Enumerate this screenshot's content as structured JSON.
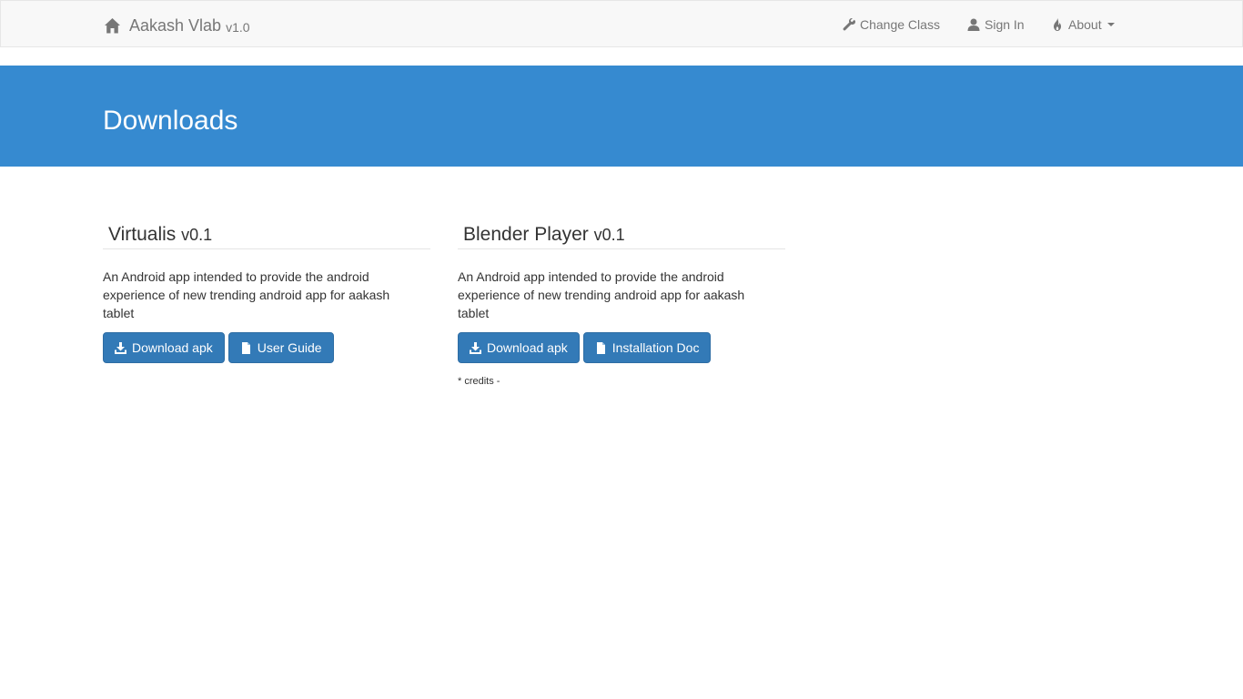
{
  "navbar": {
    "brand_title": "Aakash Vlab",
    "brand_version": "v1.0",
    "links": [
      {
        "label": "Change Class",
        "icon": "wrench-icon"
      },
      {
        "label": "Sign In",
        "icon": "user-icon"
      },
      {
        "label": "About",
        "icon": "fire-icon"
      }
    ]
  },
  "jumbotron": {
    "title": "Downloads"
  },
  "apps": [
    {
      "name": "Virtualis",
      "version": "v0.1",
      "description": "An Android app intended to provide the android experience of new trending android app for aakash tablet",
      "buttons": [
        {
          "label": "Download apk",
          "icon": "download-icon"
        },
        {
          "label": "User Guide",
          "icon": "file-icon"
        }
      ]
    },
    {
      "name": "Blender Player",
      "version": "v0.1",
      "description": "An Android app intended to provide the android experience of new trending android app for aakash tablet",
      "buttons": [
        {
          "label": "Download apk",
          "icon": "download-icon"
        },
        {
          "label": "Installation Doc",
          "icon": "file-icon"
        }
      ],
      "credits": "* credits -"
    }
  ],
  "colors": {
    "jumbotron_bg": "#368ad0",
    "button_bg": "#337ab7",
    "navbar_bg": "#f8f8f8"
  }
}
